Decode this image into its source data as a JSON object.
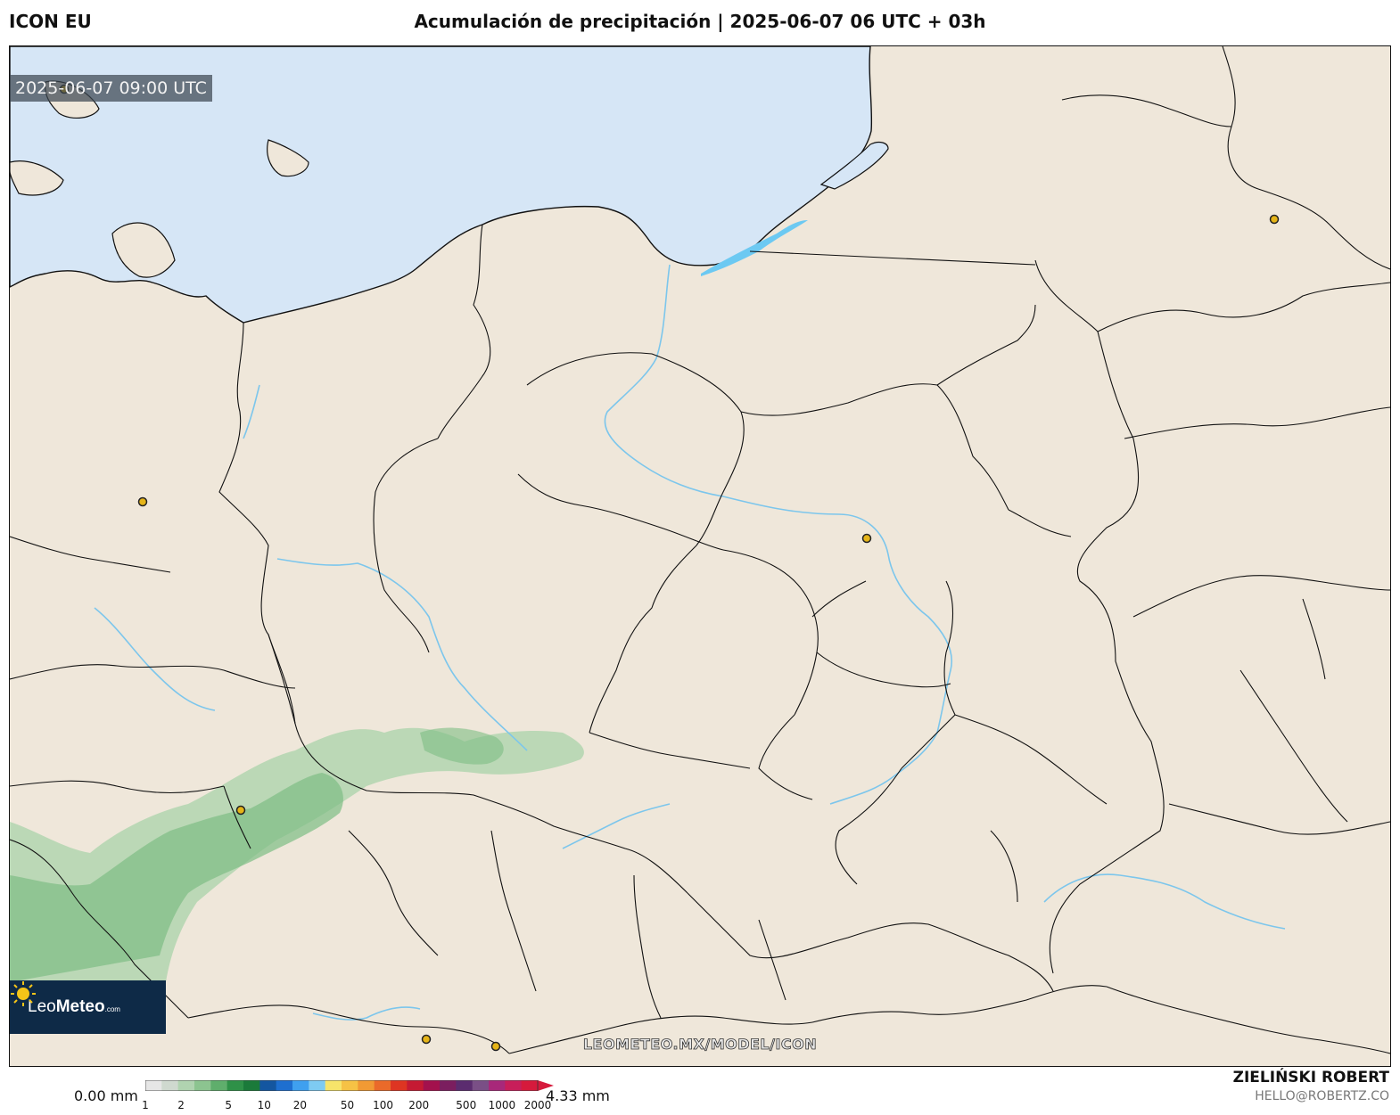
{
  "header": {
    "model": "ICON EU",
    "title": "Acumulación de precipitación | 2025-06-07 06 UTC + 03h"
  },
  "map": {
    "valid_time": "2025-06-07 09:00 UTC",
    "watermark": "LEOMETEO.MX/MODEL/ICON",
    "logo": {
      "name": "LeoMeteo",
      "part1": "Leo",
      "part2": "Meteo",
      "suffix": ".com"
    },
    "colors": {
      "sea": "#d6e6f6",
      "land": "#efe7da",
      "river": "#7cc6ec",
      "lagoon": "#6cc9f2",
      "border": "#111111",
      "city_marker": "#e5b418",
      "precip_light": "#a9d3a9",
      "precip_medium": "#7dbe84"
    }
  },
  "legend": {
    "min_label": "0.00 mm",
    "max_label": "4.33 mm",
    "ticks": [
      "1",
      "2",
      "5",
      "10",
      "20",
      "50",
      "100",
      "200",
      "500",
      "1000",
      "2000"
    ],
    "colors": [
      "#e6e6e6",
      "#cfd9cf",
      "#b0d3b0",
      "#8cc490",
      "#5fae6c",
      "#2f9148",
      "#1b7a3a",
      "#1456a0",
      "#1e6fd0",
      "#3fa0ef",
      "#7ecbf2",
      "#f7e46a",
      "#f6c245",
      "#f19a34",
      "#ea6a2a",
      "#de3522",
      "#c51a33",
      "#a3114d",
      "#7b1e5f",
      "#5b2c6f",
      "#7a4f86",
      "#a8287a",
      "#c81e5a",
      "#d61a3c"
    ]
  },
  "footer": {
    "author": "ZIELIŃSKI ROBERT",
    "email": "HELLO@ROBERTZ.CO"
  }
}
